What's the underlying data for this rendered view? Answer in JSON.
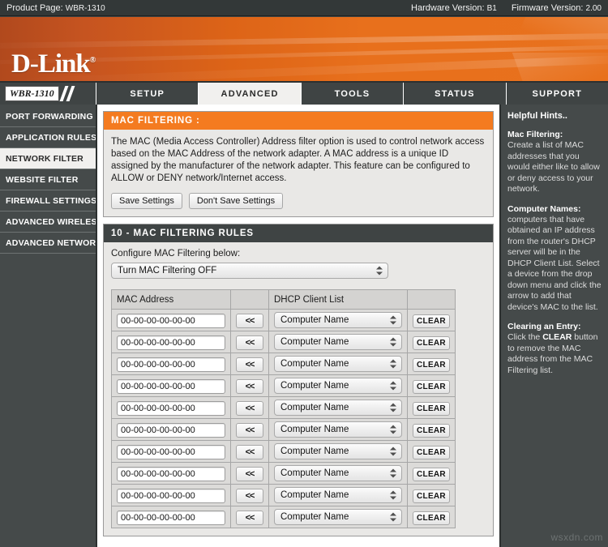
{
  "topbar": {
    "product_label": "Product Page:",
    "product_value": "WBR-1310",
    "hardware_label": "Hardware Version:",
    "hardware_value": "B1",
    "firmware_label": "Firmware Version:",
    "firmware_value": "2.00"
  },
  "brand": {
    "logo_text": "D-Link",
    "trademark": "®",
    "accent_orange": "#f47b20",
    "banner_orange": "#dd6417",
    "dark_gray": "#3f4444"
  },
  "nav": {
    "model_badge": "WBR-1310",
    "tabs": [
      {
        "label": "SETUP",
        "active": false
      },
      {
        "label": "ADVANCED",
        "active": true
      },
      {
        "label": "TOOLS",
        "active": false
      },
      {
        "label": "STATUS",
        "active": false
      },
      {
        "label": "SUPPORT",
        "active": false
      }
    ]
  },
  "sidebar": {
    "items": [
      {
        "label": "PORT FORWARDING",
        "active": false
      },
      {
        "label": "APPLICATION RULES",
        "active": false
      },
      {
        "label": "NETWORK FILTER",
        "active": true
      },
      {
        "label": "WEBSITE FILTER",
        "active": false
      },
      {
        "label": "FIREWALL SETTINGS",
        "active": false
      },
      {
        "label": "ADVANCED WIRELESS",
        "active": false
      },
      {
        "label": "ADVANCED NETWORK",
        "active": false
      }
    ]
  },
  "mac_filtering": {
    "header": "MAC FILTERING :",
    "description": "The MAC (Media Access Controller) Address filter option is used to control network access based on the MAC Address of the network adapter. A MAC address is a unique ID assigned by the manufacturer of the network adapter. This feature can be configured to ALLOW or DENY network/Internet access.",
    "save_label": "Save Settings",
    "dont_save_label": "Don't Save Settings"
  },
  "rules": {
    "header": "10 - MAC FILTERING RULES",
    "configure_label": "Configure MAC Filtering below:",
    "filter_mode_value": "Turn MAC Filtering OFF",
    "columns": [
      "MAC Address",
      "",
      "DHCP Client List",
      ""
    ],
    "arrow_label": "<<",
    "clear_label": "CLEAR",
    "rows": [
      {
        "mac": "00-00-00-00-00-00",
        "dhcp": "Computer Name"
      },
      {
        "mac": "00-00-00-00-00-00",
        "dhcp": "Computer Name"
      },
      {
        "mac": "00-00-00-00-00-00",
        "dhcp": "Computer Name"
      },
      {
        "mac": "00-00-00-00-00-00",
        "dhcp": "Computer Name"
      },
      {
        "mac": "00-00-00-00-00-00",
        "dhcp": "Computer Name"
      },
      {
        "mac": "00-00-00-00-00-00",
        "dhcp": "Computer Name"
      },
      {
        "mac": "00-00-00-00-00-00",
        "dhcp": "Computer Name"
      },
      {
        "mac": "00-00-00-00-00-00",
        "dhcp": "Computer Name"
      },
      {
        "mac": "00-00-00-00-00-00",
        "dhcp": "Computer Name"
      },
      {
        "mac": "00-00-00-00-00-00",
        "dhcp": "Computer Name"
      }
    ]
  },
  "hints": {
    "title": "Helpful Hints..",
    "sections": [
      {
        "heading": "Mac Filtering:",
        "body": "Create a list of MAC addresses that you would either like to allow or deny access to your network."
      },
      {
        "heading": "Computer Names:",
        "body": "computers that have obtained an IP address from the router's DHCP server will be in the DHCP Client List. Select a device from the drop down menu and click the arrow to add that device's MAC to the list."
      }
    ],
    "clearing_heading": "Clearing an Entry:",
    "clearing_pre": "Click the ",
    "clearing_strong": "CLEAR",
    "clearing_post": " button to remove the MAC address from the MAC Filtering list."
  },
  "watermark": "wsxdn.com"
}
